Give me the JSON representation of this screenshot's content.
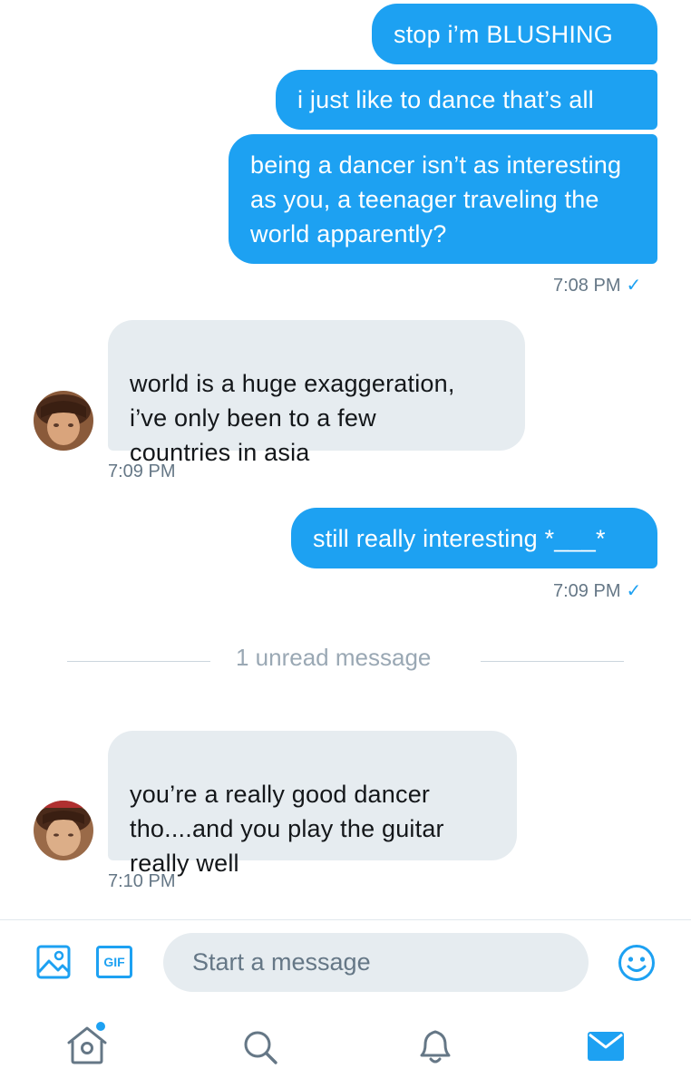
{
  "conversation": {
    "messages": [
      {
        "direction": "outgoing",
        "text": "stop i’m BLUSHING"
      },
      {
        "direction": "outgoing",
        "text": "i just like to dance that’s all"
      },
      {
        "direction": "outgoing",
        "text": "being a dancer isn’t as interesting as you, a teenager traveling the world apparently?"
      },
      {
        "direction": "incoming",
        "text": "world is a huge exaggeration,\ni’ve only been to a few\ncountries in asia"
      },
      {
        "direction": "outgoing",
        "text": "still really interesting *___*"
      },
      {
        "direction": "incoming",
        "text": "you’re a really good dancer\ntho....and you play the guitar\nreally well"
      }
    ],
    "timestamps": [
      "7:08 PM",
      "7:09 PM",
      "7:09 PM",
      "7:10 PM"
    ],
    "read_mark": "✓",
    "unread_divider": "1 unread message"
  },
  "composer": {
    "placeholder": "Start a message",
    "gif_label": "GIF",
    "icons": [
      "image-icon",
      "gif-icon",
      "emoji-icon"
    ]
  },
  "tab_bar": {
    "items": [
      "home-icon",
      "search-icon",
      "notifications-icon",
      "messages-icon"
    ],
    "active": "messages-icon",
    "home_has_new_dot": true
  },
  "colors": {
    "accent": "#1da1f2",
    "incoming_bubble": "#e6ecf0",
    "timestamp": "#657786",
    "icon_gray": "#657786"
  }
}
